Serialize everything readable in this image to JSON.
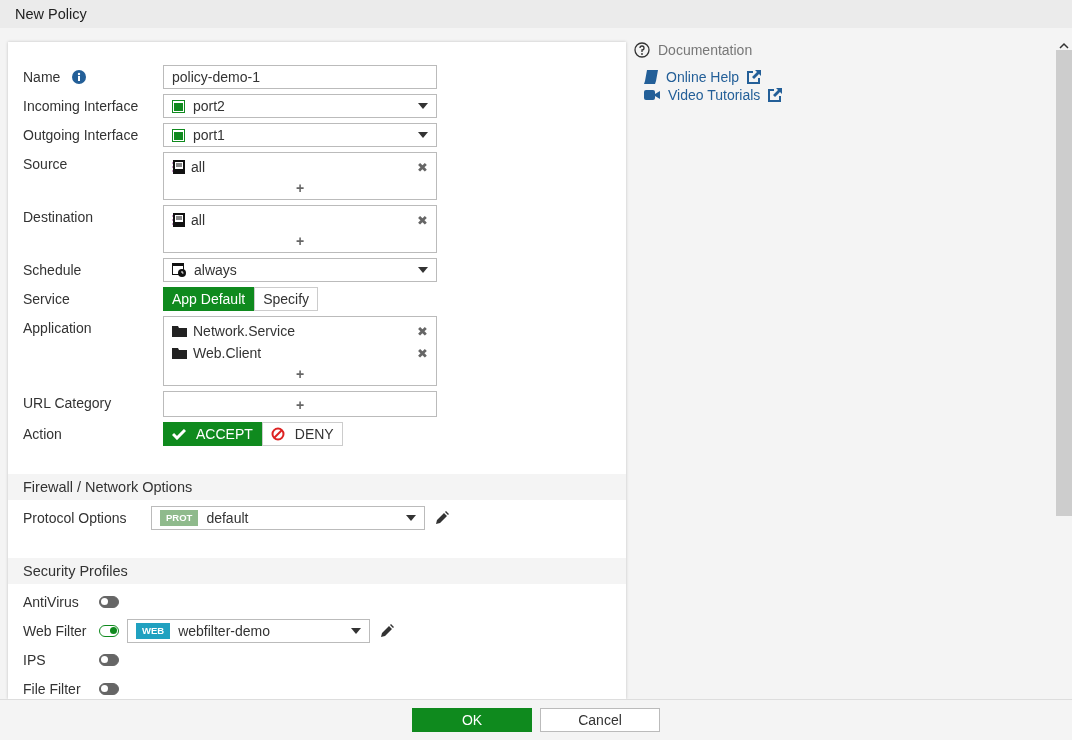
{
  "window": {
    "title": "New Policy"
  },
  "form": {
    "fields": [
      {
        "kind": "text",
        "label": "Name",
        "info": true,
        "value": "policy-demo-1"
      },
      {
        "kind": "interface",
        "label": "Incoming Interface",
        "value": "port2"
      },
      {
        "kind": "interface",
        "label": "Outgoing Interface",
        "value": "port1"
      },
      {
        "kind": "list",
        "label": "Source",
        "add": "+",
        "items": [
          {
            "kind": "address",
            "text": "all",
            "remove": "✖"
          }
        ]
      },
      {
        "kind": "list",
        "label": "Destination",
        "add": "+",
        "items": [
          {
            "kind": "address",
            "text": "all",
            "remove": "✖"
          }
        ]
      },
      {
        "kind": "schedule",
        "label": "Schedule",
        "value": "always"
      },
      {
        "kind": "choice",
        "label": "Service",
        "options": [
          {
            "label": "App Default",
            "selected": true
          },
          {
            "label": "Specify",
            "selected": false
          }
        ]
      },
      {
        "kind": "list",
        "label": "Application",
        "add": "+",
        "items": [
          {
            "kind": "folder",
            "text": "Network.Service",
            "remove": "✖"
          },
          {
            "kind": "folder",
            "text": "Web.Client",
            "remove": "✖"
          }
        ]
      },
      {
        "kind": "list",
        "label": "URL Category",
        "add": "+"
      },
      {
        "kind": "choice",
        "label": "Action",
        "options": [
          {
            "label": "ACCEPT",
            "kind": "accept",
            "selected": true
          },
          {
            "label": "DENY",
            "kind": "deny",
            "selected": false
          }
        ]
      }
    ]
  },
  "sections": [
    {
      "title": "Firewall / Network Options",
      "rows": [
        {
          "kind": "profile",
          "label": "Protocol Options",
          "badge": "PROT",
          "color": "#8fba8c",
          "value": "default"
        }
      ]
    },
    {
      "title": "Security Profiles",
      "rows": [
        {
          "kind": "toggle",
          "label": "AntiVirus",
          "on": false
        },
        {
          "kind": "toggle",
          "label": "Web Filter",
          "on": true,
          "badge": "WEB",
          "color": "#20a1c0",
          "value": "webfilter-demo"
        },
        {
          "kind": "toggle",
          "label": "IPS",
          "on": false
        },
        {
          "kind": "toggle",
          "label": "File Filter",
          "on": false
        }
      ]
    }
  ],
  "documentation": {
    "title": "Documentation",
    "links": [
      {
        "kind": "book",
        "label": "Online Help"
      },
      {
        "kind": "video",
        "label": "Video Tutorials"
      }
    ]
  },
  "buttons": [
    {
      "label": "OK",
      "primary": true
    },
    {
      "label": "Cancel",
      "primary": false
    }
  ]
}
